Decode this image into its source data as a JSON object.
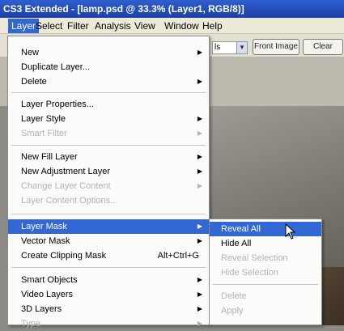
{
  "window": {
    "title": "CS3 Extended - [lamp.psd @ 33.3% (Layer1, RGB/8)]"
  },
  "menubar": [
    "Layer",
    "Select",
    "Filter",
    "Analysis",
    "View",
    "Window",
    "Help"
  ],
  "options_bar": {
    "field_value": "ls",
    "buttons": [
      "Front Image",
      "Clear"
    ]
  },
  "layer_menu": {
    "items": [
      {
        "label": "New",
        "submenu": true
      },
      {
        "label": "Duplicate Layer..."
      },
      {
        "label": "Delete",
        "submenu": true
      },
      {
        "label": "Layer Properties..."
      },
      {
        "label": "Layer Style",
        "submenu": true
      },
      {
        "label": "Smart Filter",
        "submenu": true,
        "disabled": true
      },
      {
        "label": "New Fill Layer",
        "submenu": true
      },
      {
        "label": "New Adjustment Layer",
        "submenu": true
      },
      {
        "label": "Change Layer Content",
        "submenu": true,
        "disabled": true
      },
      {
        "label": "Layer Content Options...",
        "disabled": true
      },
      {
        "label": "Layer Mask",
        "submenu": true,
        "highlighted": true
      },
      {
        "label": "Vector Mask",
        "submenu": true
      },
      {
        "label": "Create Clipping Mask",
        "shortcut": "Alt+Ctrl+G"
      },
      {
        "label": "Smart Objects",
        "submenu": true
      },
      {
        "label": "Video Layers",
        "submenu": true
      },
      {
        "label": "3D Layers",
        "submenu": true
      },
      {
        "label": "Type",
        "submenu": true,
        "disabled": true
      }
    ]
  },
  "layer_mask_submenu": {
    "items": [
      {
        "label": "Reveal All",
        "highlighted": true
      },
      {
        "label": "Hide All"
      },
      {
        "label": "Reveal Selection",
        "disabled": true
      },
      {
        "label": "Hide Selection",
        "disabled": true
      },
      {
        "label": "Delete",
        "disabled": true
      },
      {
        "label": "Apply",
        "disabled": true
      }
    ]
  }
}
